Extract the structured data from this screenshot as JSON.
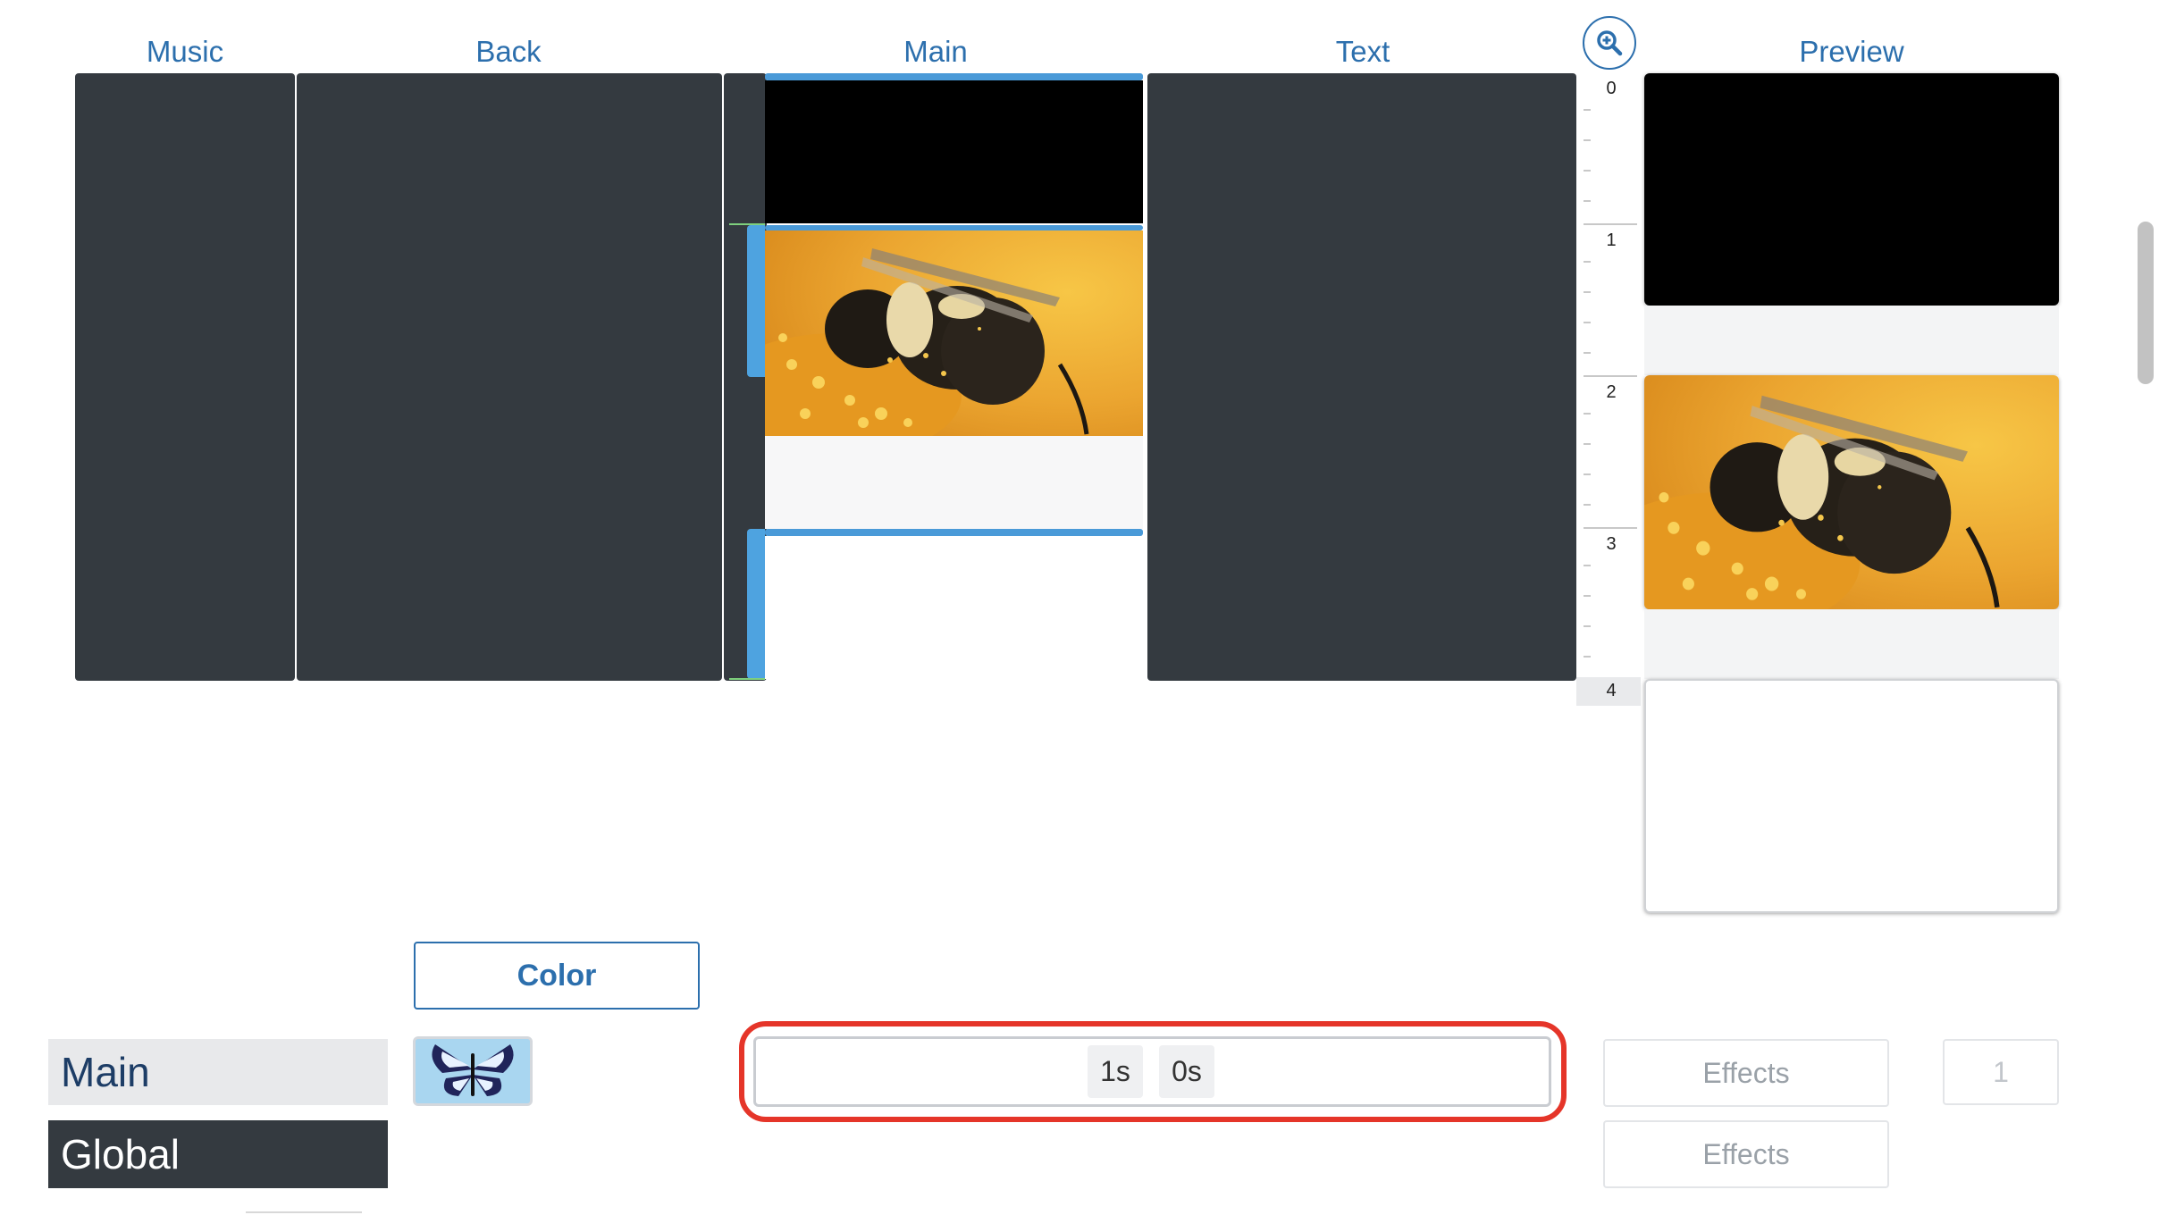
{
  "columns": {
    "music": "Music",
    "back": "Back",
    "main": "Main",
    "text": "Text",
    "preview": "Preview"
  },
  "ruler": [
    "0",
    "1",
    "2",
    "3",
    "4"
  ],
  "toolbar": {
    "zoom_icon": "zoom-in-icon",
    "color_button": "Color"
  },
  "tabs": {
    "main": "Main",
    "global": "Global"
  },
  "duration": {
    "seconds_chip": "1s",
    "offset_chip": "0s"
  },
  "effects": {
    "main_label": "Effects",
    "global_label": "Effects"
  },
  "counter": "1",
  "colors": {
    "accent": "#2c6fad",
    "lane": "#343a40",
    "clip_bar": "#4a9ad8",
    "highlight": "#e53529"
  }
}
